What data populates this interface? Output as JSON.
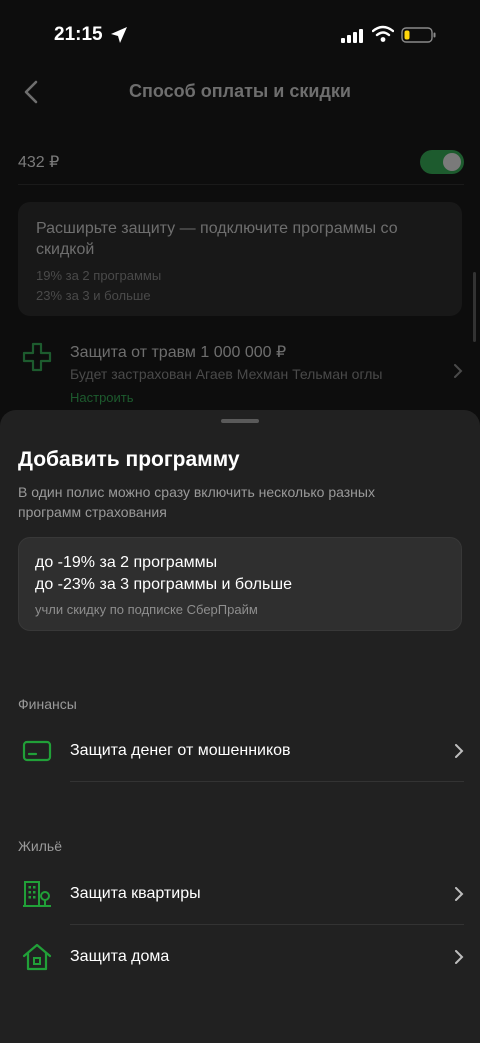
{
  "status_bar": {
    "time": "21:15"
  },
  "header": {
    "title": "Способ оплаты и скидки"
  },
  "background": {
    "price": "432 ₽",
    "promo": {
      "title": "Расширьте защиту — подключите программы со скидкой",
      "line1": "19% за 2 программы",
      "line2": "23% за 3 и больше"
    },
    "trauma": {
      "title": "Защита от травм 1 000 000 ₽",
      "subtitle": "Будет застрахован Агаев Мехман Тельман оглы",
      "link": "Настроить"
    }
  },
  "sheet": {
    "title": "Добавить программу",
    "description": "В один полис можно сразу включить несколько разных программ страхования",
    "discount": {
      "line1": "до -19% за 2 программы",
      "line2": "до -23% за 3 программы и больше",
      "note": "учли скидку по подписке СберПрайм"
    },
    "sections": [
      {
        "label": "Финансы",
        "items": [
          {
            "label": "Защита денег от мошенников",
            "icon": "card-icon"
          }
        ]
      },
      {
        "label": "Жильё",
        "items": [
          {
            "label": "Защита квартиры",
            "icon": "building-icon"
          },
          {
            "label": "Защита дома",
            "icon": "house-icon"
          }
        ]
      }
    ]
  },
  "colors": {
    "accent": "#21a038",
    "sheet_bg": "#212121",
    "card_bg": "#2f2f2f"
  }
}
